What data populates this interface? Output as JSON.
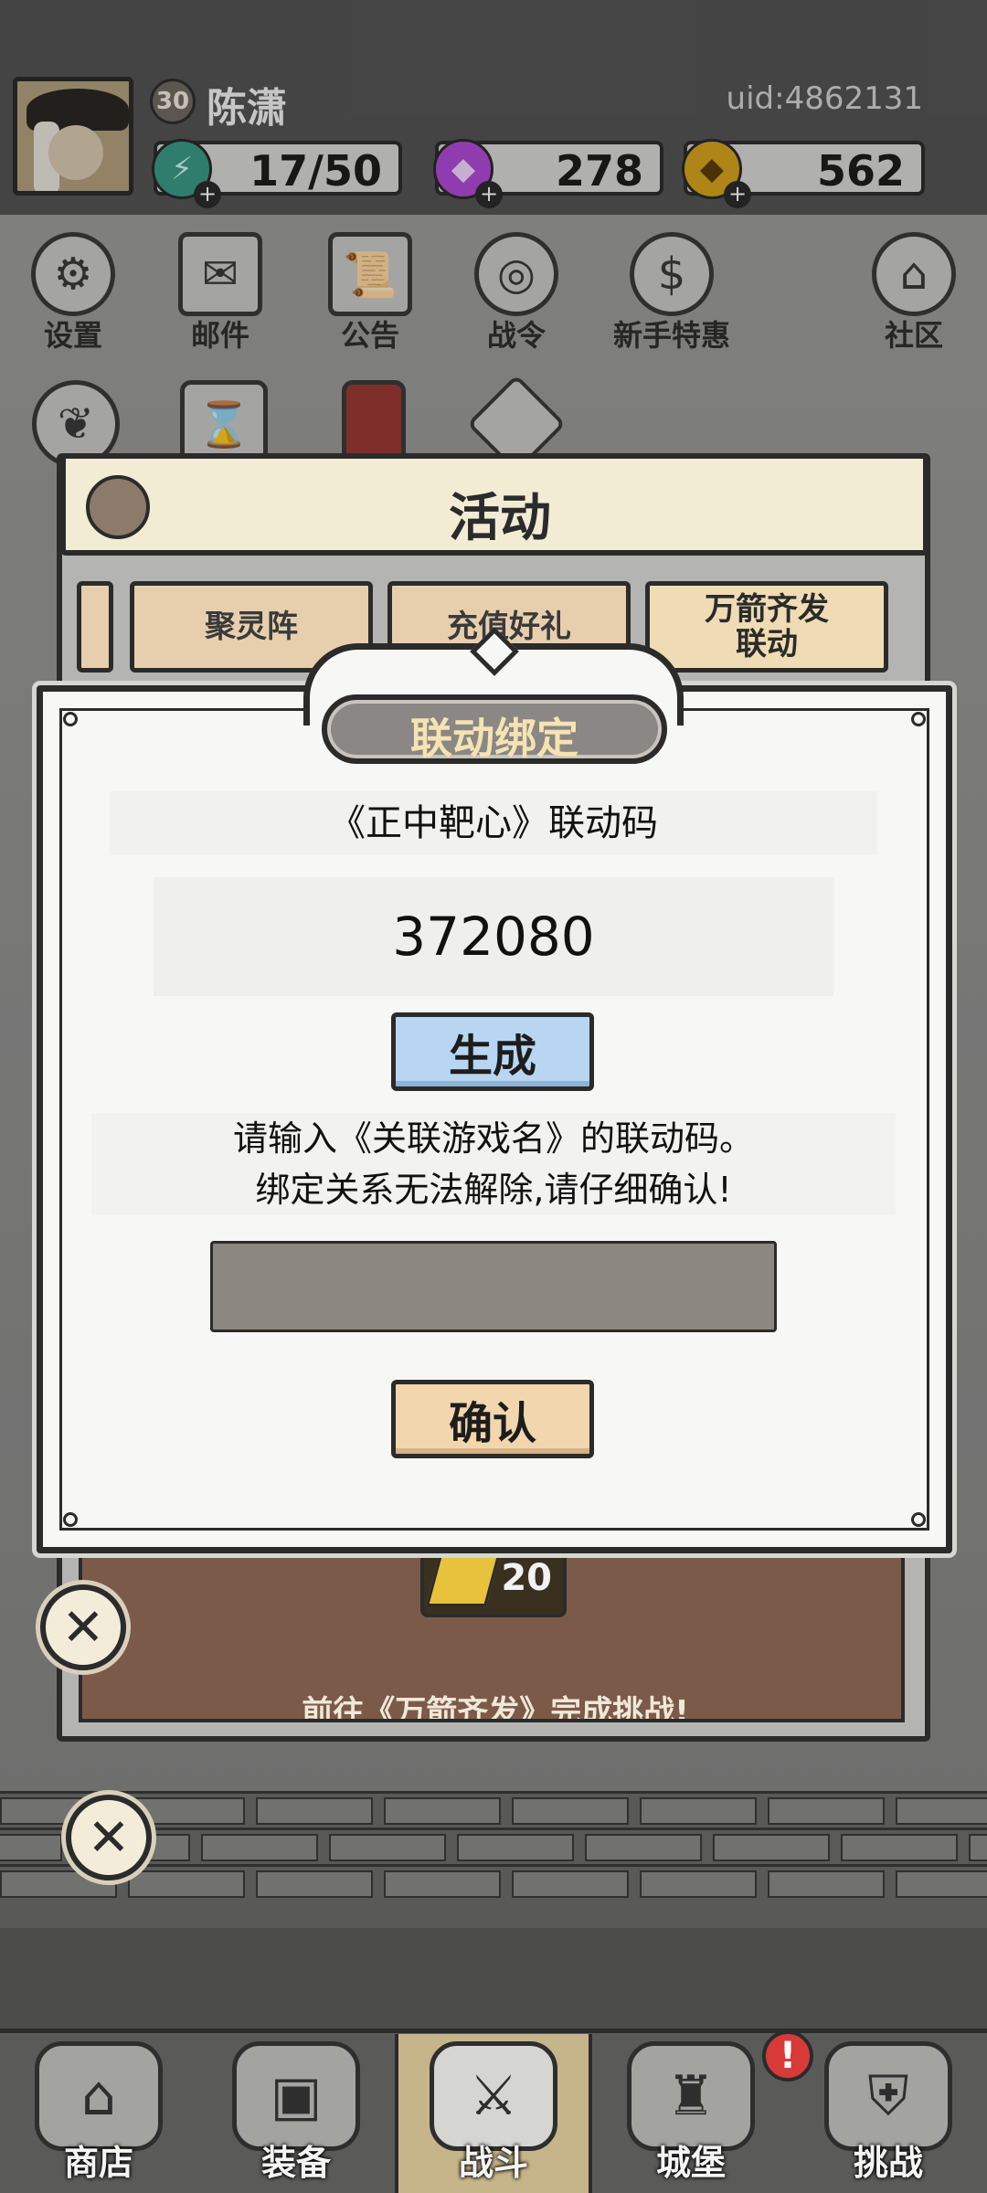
{
  "player": {
    "name": "陈潇",
    "level": "30",
    "uid": "uid:4862131"
  },
  "resources": {
    "energy": "17/50",
    "gems": "278",
    "coins": "562"
  },
  "menu": [
    {
      "label": "设置",
      "icon": "gear-icon"
    },
    {
      "label": "邮件",
      "icon": "envelope-icon"
    },
    {
      "label": "公告",
      "icon": "scroll-icon"
    },
    {
      "label": "战令",
      "icon": "crystal-ball-icon"
    },
    {
      "label": "新手特惠",
      "icon": "money-bag-icon"
    },
    {
      "label": "社区",
      "icon": "home-icon"
    }
  ],
  "activity": {
    "title": "活动",
    "tabs": [
      "聚灵阵",
      "充值好礼",
      "万箭齐发\n联动"
    ],
    "banner_text": "前往《万箭齐发》完成挑战!",
    "reward_count": "20"
  },
  "dialog": {
    "title": "联动绑定",
    "code_title": "《正中靶心》联动码",
    "code_value": "372080",
    "generate_label": "生成",
    "hint_line1": "请输入《关联游戏名》的联动码。",
    "hint_line2": "绑定关系无法解除,请仔细确认!",
    "input_value": "",
    "confirm_label": "确认"
  },
  "nav": [
    {
      "label": "商店",
      "icon": "shop-icon"
    },
    {
      "label": "装备",
      "icon": "backpack-icon"
    },
    {
      "label": "战斗",
      "icon": "crossed-swords-icon"
    },
    {
      "label": "城堡",
      "icon": "castle-icon"
    },
    {
      "label": "挑战",
      "icon": "shield-icon"
    }
  ],
  "nav_alert": "!",
  "colors": {
    "generate_button": "#b8d6f2",
    "confirm_button": "#f2d6ad",
    "title_text": "#f5e3b3",
    "alert": "#d83a3a"
  }
}
